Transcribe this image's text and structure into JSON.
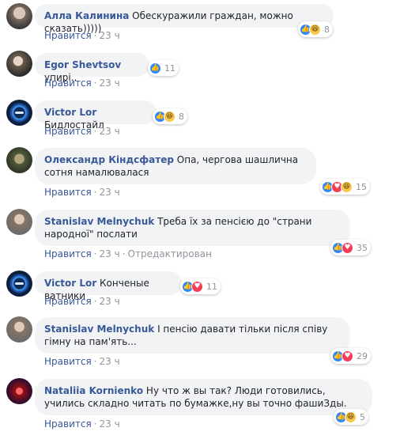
{
  "comments": [
    {
      "author": "Алла Калинина",
      "text": "Обескуражили граждан, можно сказать)))))",
      "reaction_count": "8",
      "reactions": [
        "like",
        "haha"
      ],
      "like_label": "Нравится",
      "time": "23 ч",
      "edited": ""
    },
    {
      "author": "Egor Shevtsov",
      "text": "упирi..",
      "reaction_count": "11",
      "reactions": [
        "like"
      ],
      "like_label": "Нравится",
      "time": "23 ч",
      "edited": ""
    },
    {
      "author": "Victor Lor",
      "text": "Бидлостайл",
      "reaction_count": "8",
      "reactions": [
        "like",
        "haha"
      ],
      "like_label": "Нравится",
      "time": "23 ч",
      "edited": ""
    },
    {
      "author": "Олександр Кіндсфатер",
      "text": "Опа, чергова шашлична сотня намалювалася",
      "reaction_count": "15",
      "reactions": [
        "like",
        "love",
        "haha"
      ],
      "like_label": "Нравится",
      "time": "23 ч",
      "edited": ""
    },
    {
      "author": "Stanislav Melnychuk",
      "text": "Треба їх за пенсією до \"страни народної\" послати",
      "reaction_count": "35",
      "reactions": [
        "like",
        "love"
      ],
      "like_label": "Нравится",
      "time": "23 ч",
      "edited": "Отредактирован"
    },
    {
      "author": "Victor Lor",
      "text": "Конченые ватники",
      "reaction_count": "11",
      "reactions": [
        "like",
        "love"
      ],
      "like_label": "Нравится",
      "time": "23 ч",
      "edited": ""
    },
    {
      "author": "Stanislav Melnychuk",
      "text": "І пенсію давати тільки після співу гімну на пам'ять...",
      "reaction_count": "29",
      "reactions": [
        "like",
        "love"
      ],
      "like_label": "Нравится",
      "time": "23 ч",
      "edited": ""
    },
    {
      "author": "Nataliia Kornienko",
      "text": "Ну что ж вы так? Люди готовились, учились складно читать по бумажке,ну вы точно фашиЗды.",
      "reaction_count": "5",
      "reactions": [
        "like",
        "haha"
      ],
      "like_label": "Нравится",
      "time": "23 ч",
      "edited": ""
    }
  ]
}
